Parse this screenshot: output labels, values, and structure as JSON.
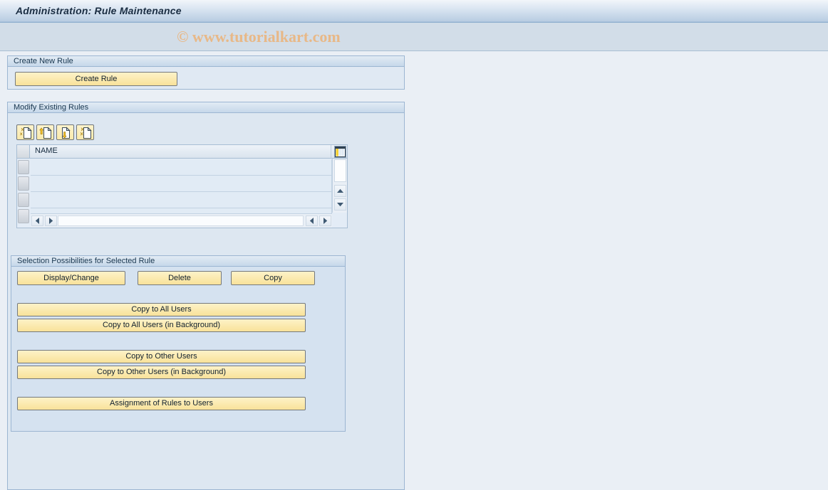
{
  "window": {
    "title": "Administration: Rule Maintenance",
    "watermark": "© www.tutorialkart.com"
  },
  "create_new_rule": {
    "group_label": "Create New Rule",
    "create_rule_label": "Create Rule"
  },
  "modify_existing_rules": {
    "group_label": "Modify Existing Rules",
    "toolbar": [
      {
        "name": "create-rule-icon",
        "tooltip": "Create"
      },
      {
        "name": "upload-rule-icon",
        "tooltip": "Upload"
      },
      {
        "name": "download-rule-icon",
        "tooltip": "Download"
      },
      {
        "name": "change-rule-icon",
        "tooltip": "Change"
      }
    ],
    "grid": {
      "settings_icon": "table-settings-icon",
      "columns": [
        "NAME"
      ],
      "rows": [
        {
          "name": ""
        },
        {
          "name": ""
        },
        {
          "name": ""
        },
        {
          "name": ""
        }
      ]
    }
  },
  "selection_possibilities": {
    "group_label": "Selection Possibilities for Selected Rule",
    "buttons": {
      "display_change": "Display/Change",
      "delete": "Delete",
      "copy": "Copy",
      "copy_all_users": "Copy to All Users",
      "copy_all_users_bg": "Copy to All Users (in Background)",
      "copy_other_users": "Copy to Other Users",
      "copy_other_users_bg": "Copy to Other Users (in Background)",
      "assignment_rules_users": "Assignment of Rules to Users"
    }
  },
  "colors": {
    "title_bar": "#b9cde2",
    "watermark": "#e8b887",
    "button_face": "#fbeab0",
    "group_border": "#9cb6d2",
    "page_background": "#eaeff5"
  }
}
